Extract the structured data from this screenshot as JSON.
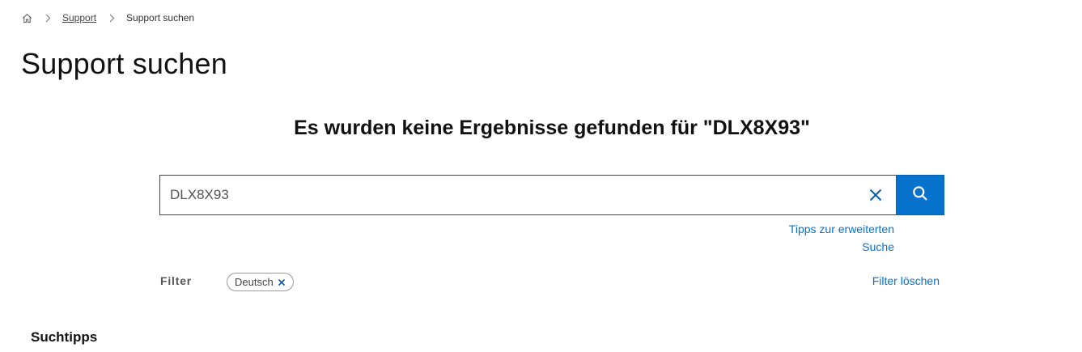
{
  "breadcrumb": {
    "home_icon": "home-icon",
    "separator_icon": "chevron-right-icon",
    "items": [
      {
        "label": "Support"
      },
      {
        "label": "Support suchen"
      }
    ]
  },
  "page_title": "Support suchen",
  "results_heading": "Es wurden keine Ergebnisse gefunden für \"DLX8X93\"",
  "search": {
    "value": "DLX8X93",
    "clear_icon": "close-icon",
    "submit_icon": "search-icon"
  },
  "advanced_tips": {
    "line1": "Tipps zur erweiterten",
    "line2": "Suche"
  },
  "filter": {
    "label": "Filter",
    "chips": [
      {
        "label": "Deutsch",
        "remove_icon": "close-icon"
      }
    ],
    "clear_label": "Filter löschen"
  },
  "search_tips_heading": "Suchtipps",
  "colors": {
    "accent": "#0672cb",
    "text": "#111111",
    "muted": "#555555"
  }
}
